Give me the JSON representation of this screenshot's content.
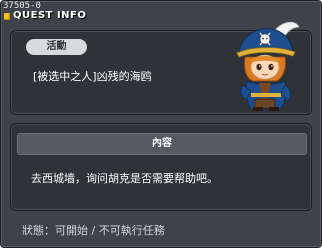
{
  "quest": {
    "id": "37505-0",
    "window_title": "QUEST INFO",
    "category": "活動",
    "name": "[被选中之人]凶残的海鸥",
    "content_header": "內容",
    "description": "去西城墙，询问胡克是否需要帮助吧。",
    "status": "狀態：可開始 / 不可執行任務"
  },
  "icons": {
    "title": "quest-title-icon",
    "npc": "pirate-captain-npc-portrait"
  },
  "colors": {
    "window_bg": "#3f4349",
    "panel_bg": "#2f3236",
    "badge_bg": "#d8dadc",
    "content_bar_bg": "#555a60",
    "title_icon": "#f2c21a"
  }
}
